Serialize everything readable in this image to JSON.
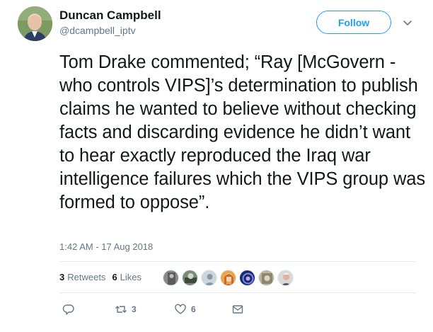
{
  "author": {
    "name": "Duncan Campbell",
    "handle": "@dcampbell_iptv"
  },
  "follow_label": "Follow",
  "tweet": {
    "text": "Tom Drake commented;  “Ray [McGovern - who controls VIPS]’s determination to publish claims he wanted to believe without checking facts and discarding evidence he didn’t want to hear exactly reproduced the Iraq war intelligence failures which the VIPS group was formed to oppose”.",
    "timestamp": "1:42 AM - 17 Aug 2018"
  },
  "stats": {
    "retweets_count": "3",
    "retweets_label": "Retweets",
    "likes_count": "6",
    "likes_label": "Likes"
  },
  "actions": {
    "reply_count": "",
    "retweet_count": "3",
    "like_count": "6"
  },
  "icons": [
    "reply-icon",
    "retweet-icon",
    "like-icon",
    "message-icon",
    "chevron-down-icon"
  ],
  "colors": {
    "accent": "#1da1f2",
    "secondary_text": "#657786",
    "divider": "#e6ecf0"
  }
}
